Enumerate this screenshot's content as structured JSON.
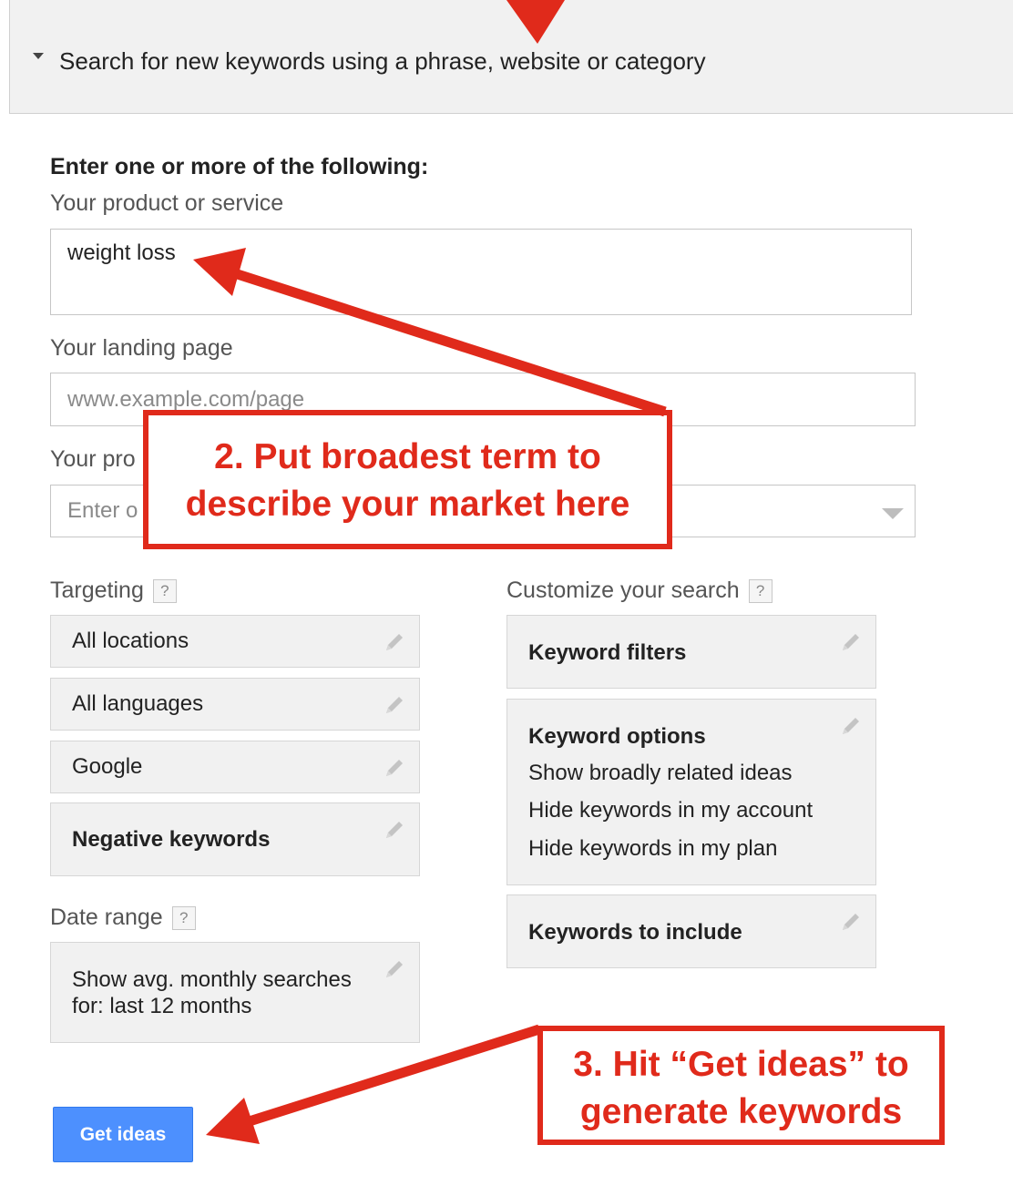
{
  "header": {
    "title": "Search for new keywords using a phrase, website or category"
  },
  "form": {
    "section_title": "Enter one or more of the following:",
    "product_label": "Your product or service",
    "product_value": "weight loss",
    "landing_label": "Your landing page",
    "landing_placeholder": "www.example.com/page",
    "category_label": "Your pro",
    "category_placeholder": "Enter o"
  },
  "targeting": {
    "label": "Targeting",
    "help": "?",
    "items": [
      {
        "label": "All locations"
      },
      {
        "label": "All languages"
      },
      {
        "label": "Google"
      },
      {
        "label": "Negative keywords"
      }
    ]
  },
  "date_range": {
    "label": "Date range",
    "help": "?",
    "line1": "Show avg. monthly searches",
    "line2": "for: last 12 months"
  },
  "customize": {
    "label": "Customize your search",
    "help": "?",
    "keyword_filters": "Keyword filters",
    "keyword_options": {
      "title": "Keyword options",
      "lines": [
        "Show broadly related ideas",
        "Hide keywords in my account",
        "Hide keywords in my plan"
      ]
    },
    "keywords_to_include": "Keywords to include"
  },
  "actions": {
    "get_ideas": "Get ideas"
  },
  "annotations": {
    "step2_line1": "2. Put broadest term to",
    "step2_line2": "describe your market here",
    "step3_line1": "3. Hit “Get ideas” to",
    "step3_line2": "generate keywords",
    "color": "#e02a1b"
  },
  "icons": {
    "toggle": "triangle-down-icon",
    "edit": "pencil-icon",
    "help": "question-mark-icon",
    "select": "caret-down-icon"
  }
}
